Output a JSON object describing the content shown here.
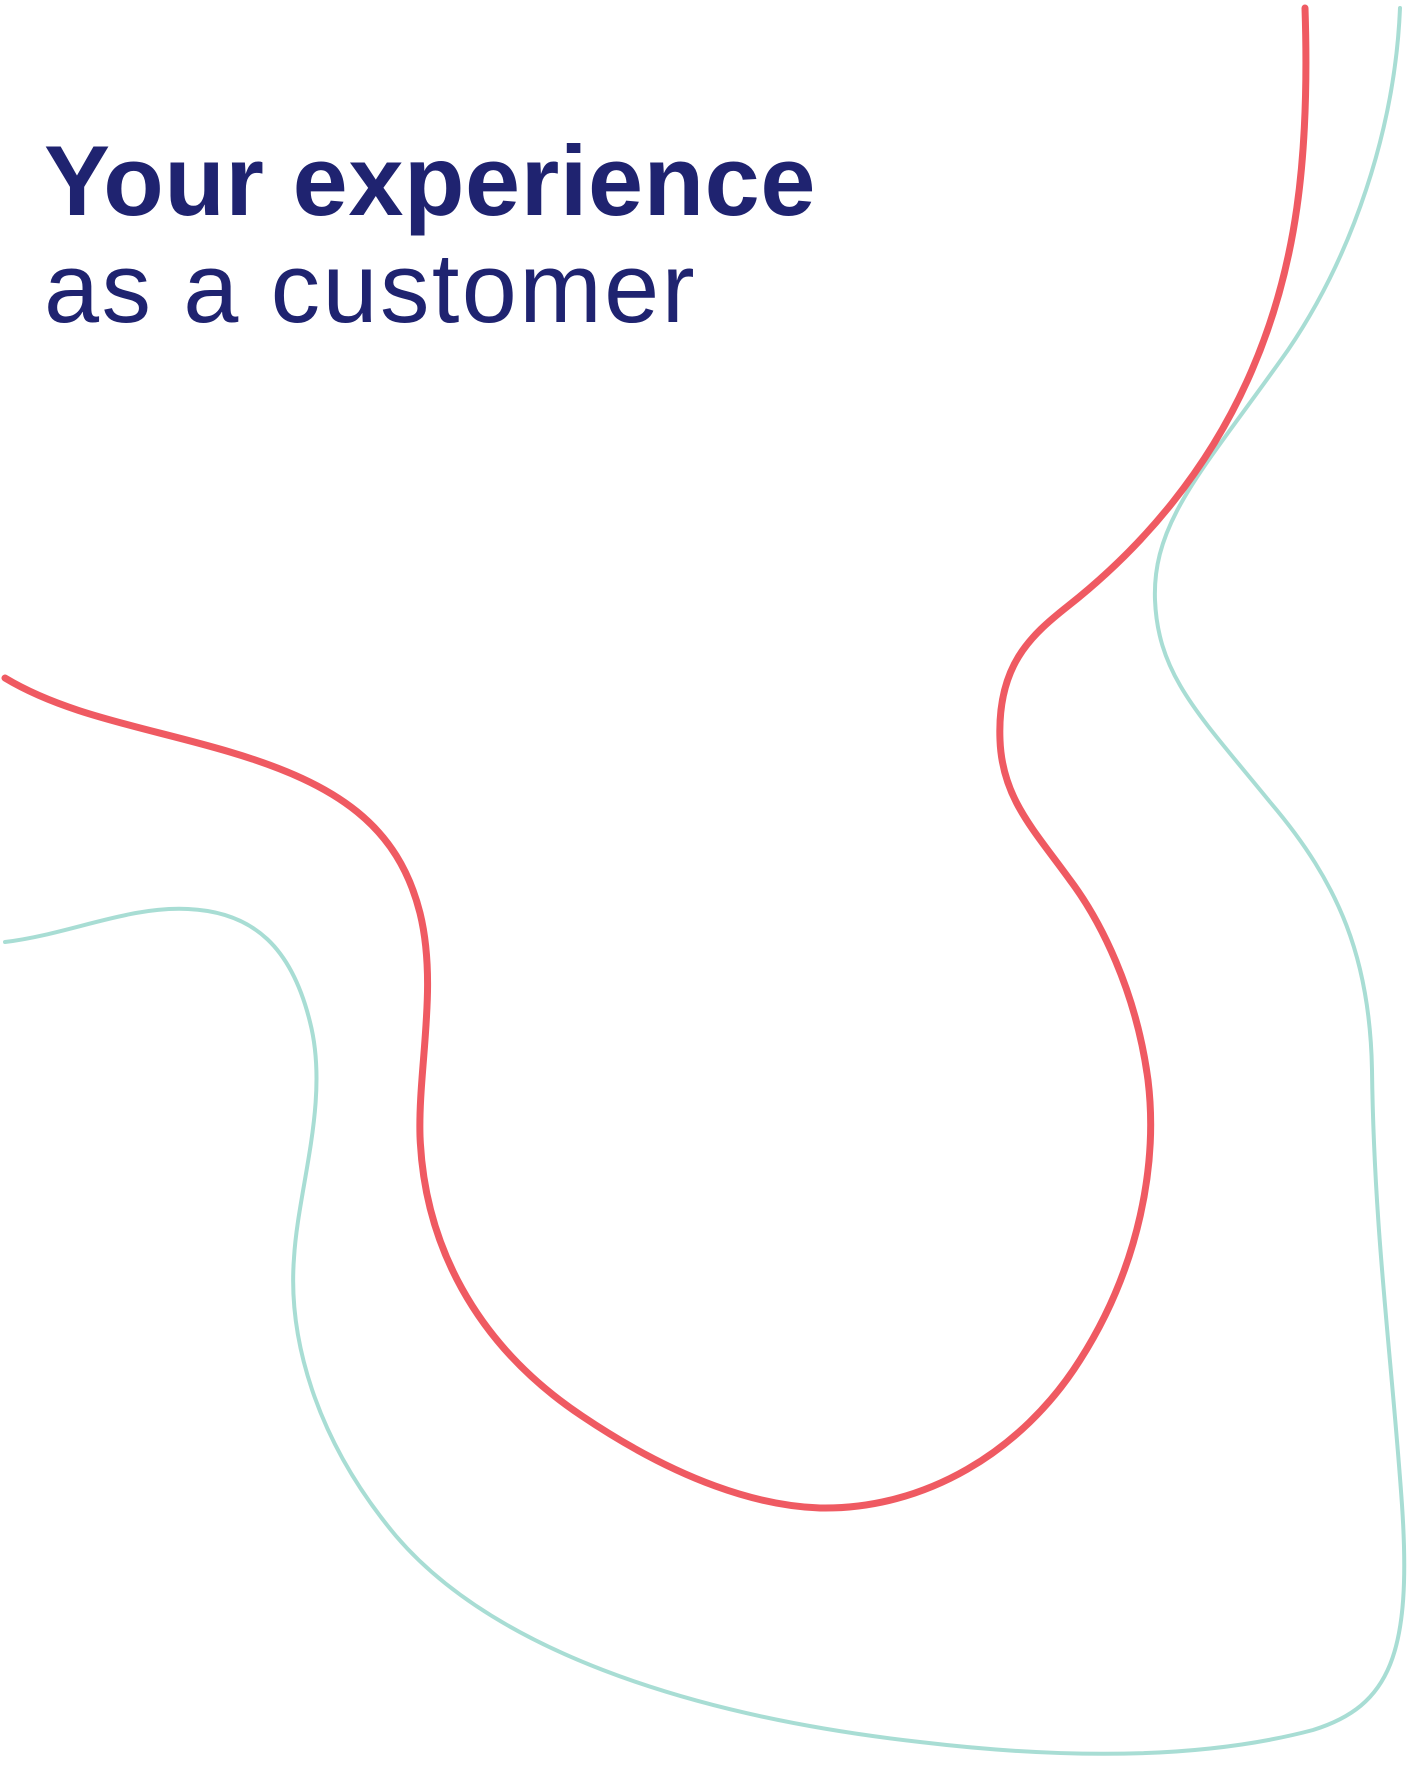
{
  "document": {
    "title_bold": "Your experience",
    "title_light": "as a customer"
  },
  "decoration": {
    "accent_line_color": "#ef5a62",
    "secondary_line_color": "#a8ddd4",
    "title_color": "#1f2370"
  }
}
